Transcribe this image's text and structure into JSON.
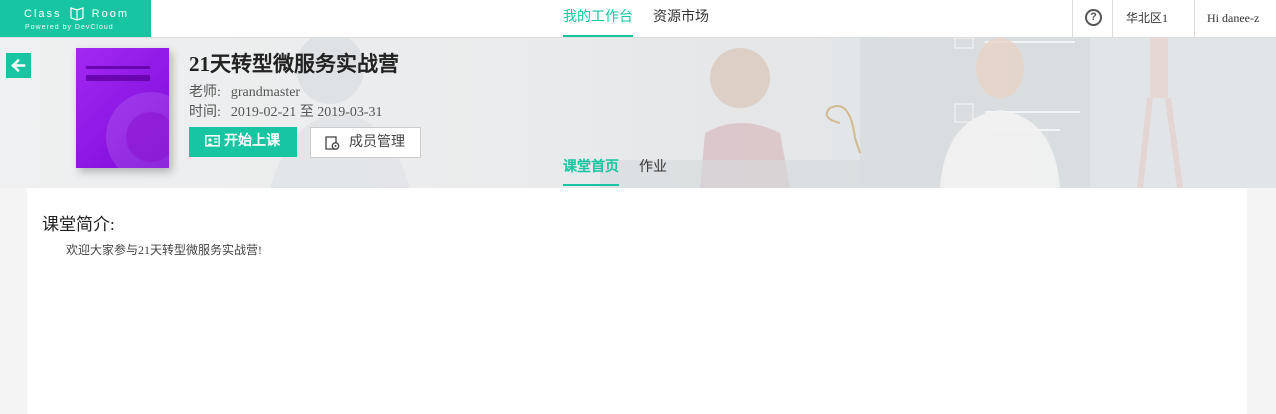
{
  "header": {
    "logo_title_left": "Class",
    "logo_title_right": "Room",
    "logo_subtitle": "Powered by DevCloud",
    "nav": [
      {
        "label": "我的工作台",
        "active": true
      },
      {
        "label": "资源市场",
        "active": false
      }
    ],
    "help_icon": "question-circle-icon",
    "region": "华北区1",
    "user_greeting": "Hi danee-z"
  },
  "course": {
    "title": "21天转型微服务实战营",
    "teacher_label": "老师:",
    "teacher_name": "grandmaster",
    "time_label": "时间:",
    "time_range": "2019-02-21 至 2019-03-31",
    "start_button": "开始上课",
    "members_button": "成员管理"
  },
  "tabs": [
    {
      "label": "课堂首页",
      "active": true
    },
    {
      "label": "作业",
      "active": false
    }
  ],
  "intro": {
    "heading": "课堂简介:",
    "text": "欢迎大家参与21天转型微服务实战营!"
  },
  "colors": {
    "accent": "#18c5a2",
    "cover_purple": "#9a1fe8"
  }
}
